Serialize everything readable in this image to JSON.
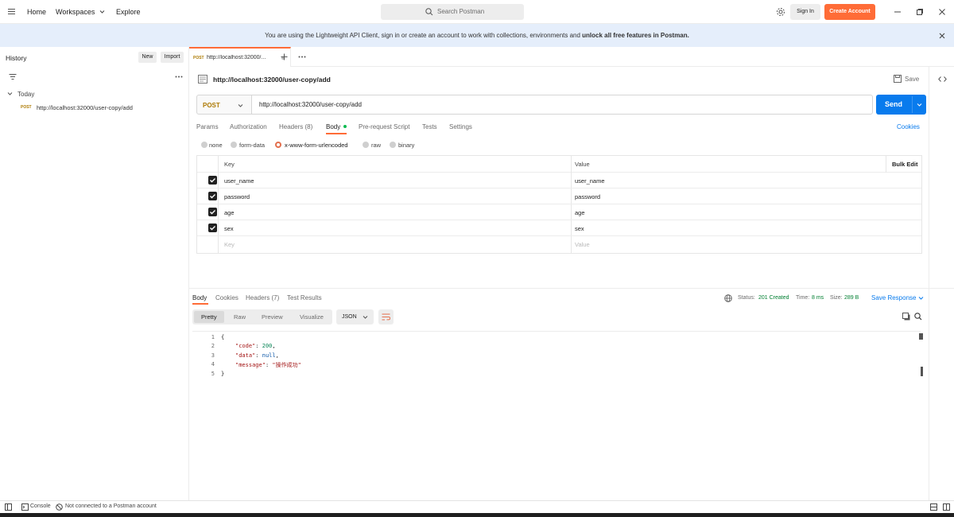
{
  "topbar": {
    "nav": [
      "Home",
      "Workspaces",
      "Explore"
    ],
    "search_placeholder": "Search Postman",
    "sign_in": "Sign In",
    "create_account": "Create Account"
  },
  "banner": {
    "text_part1": "You are using the Lightweight API Client, sign in or create an account to work with collections, environments and ",
    "text_bold": "unlock all free features in Postman."
  },
  "sidebar": {
    "title": "History",
    "new_label": "New",
    "import_label": "Import",
    "group": "Today",
    "items": [
      {
        "method": "POST",
        "url": "http://localhost:32000/user-copy/add"
      }
    ]
  },
  "tabs": [
    {
      "method": "POST",
      "label": "http://localhost:32000/..."
    }
  ],
  "request": {
    "title": "http://localhost:32000/user-copy/add",
    "save_label": "Save",
    "method": "POST",
    "url": "http://localhost:32000/user-copy/add",
    "send_label": "Send",
    "subtabs": [
      "Params",
      "Authorization",
      "Headers",
      "Body",
      "Pre-request Script",
      "Tests",
      "Settings"
    ],
    "headers_count": "(8)",
    "cookies_label": "Cookies",
    "body_types": [
      "none",
      "form-data",
      "x-www-form-urlencoded",
      "raw",
      "binary"
    ],
    "table": {
      "key_header": "Key",
      "value_header": "Value",
      "bulk_edit": "Bulk Edit",
      "rows": [
        {
          "key": "user_name",
          "value": "user_name"
        },
        {
          "key": "password",
          "value": "password"
        },
        {
          "key": "age",
          "value": "age"
        },
        {
          "key": "sex",
          "value": "sex"
        }
      ],
      "key_placeholder": "Key",
      "value_placeholder": "Value"
    }
  },
  "response": {
    "tabs": [
      "Body",
      "Cookies",
      "Headers",
      "Test Results"
    ],
    "headers_count": "(7)",
    "status_label": "Status:",
    "status_value": "201 Created",
    "time_label": "Time:",
    "time_value": "8 ms",
    "size_label": "Size:",
    "size_value": "289 B",
    "save_response": "Save Response",
    "views": [
      "Pretty",
      "Raw",
      "Preview",
      "Visualize"
    ],
    "format": "JSON",
    "lines": {
      "l1": "{",
      "code_key": "\"code\"",
      "code_val": "200",
      "data_key": "\"data\"",
      "data_val": "null",
      "message_key": "\"message\"",
      "message_val": "\"操作成功\"",
      "l5": "}"
    },
    "line_numbers": [
      "1",
      "2",
      "3",
      "4",
      "5"
    ]
  },
  "statusbar": {
    "console": "Console",
    "account": "Not connected to a Postman account"
  },
  "colors": {
    "accent": "#ff6c37",
    "send_blue": "#097bed",
    "status_green": "#007f31",
    "post_method": "#ad7a03"
  }
}
